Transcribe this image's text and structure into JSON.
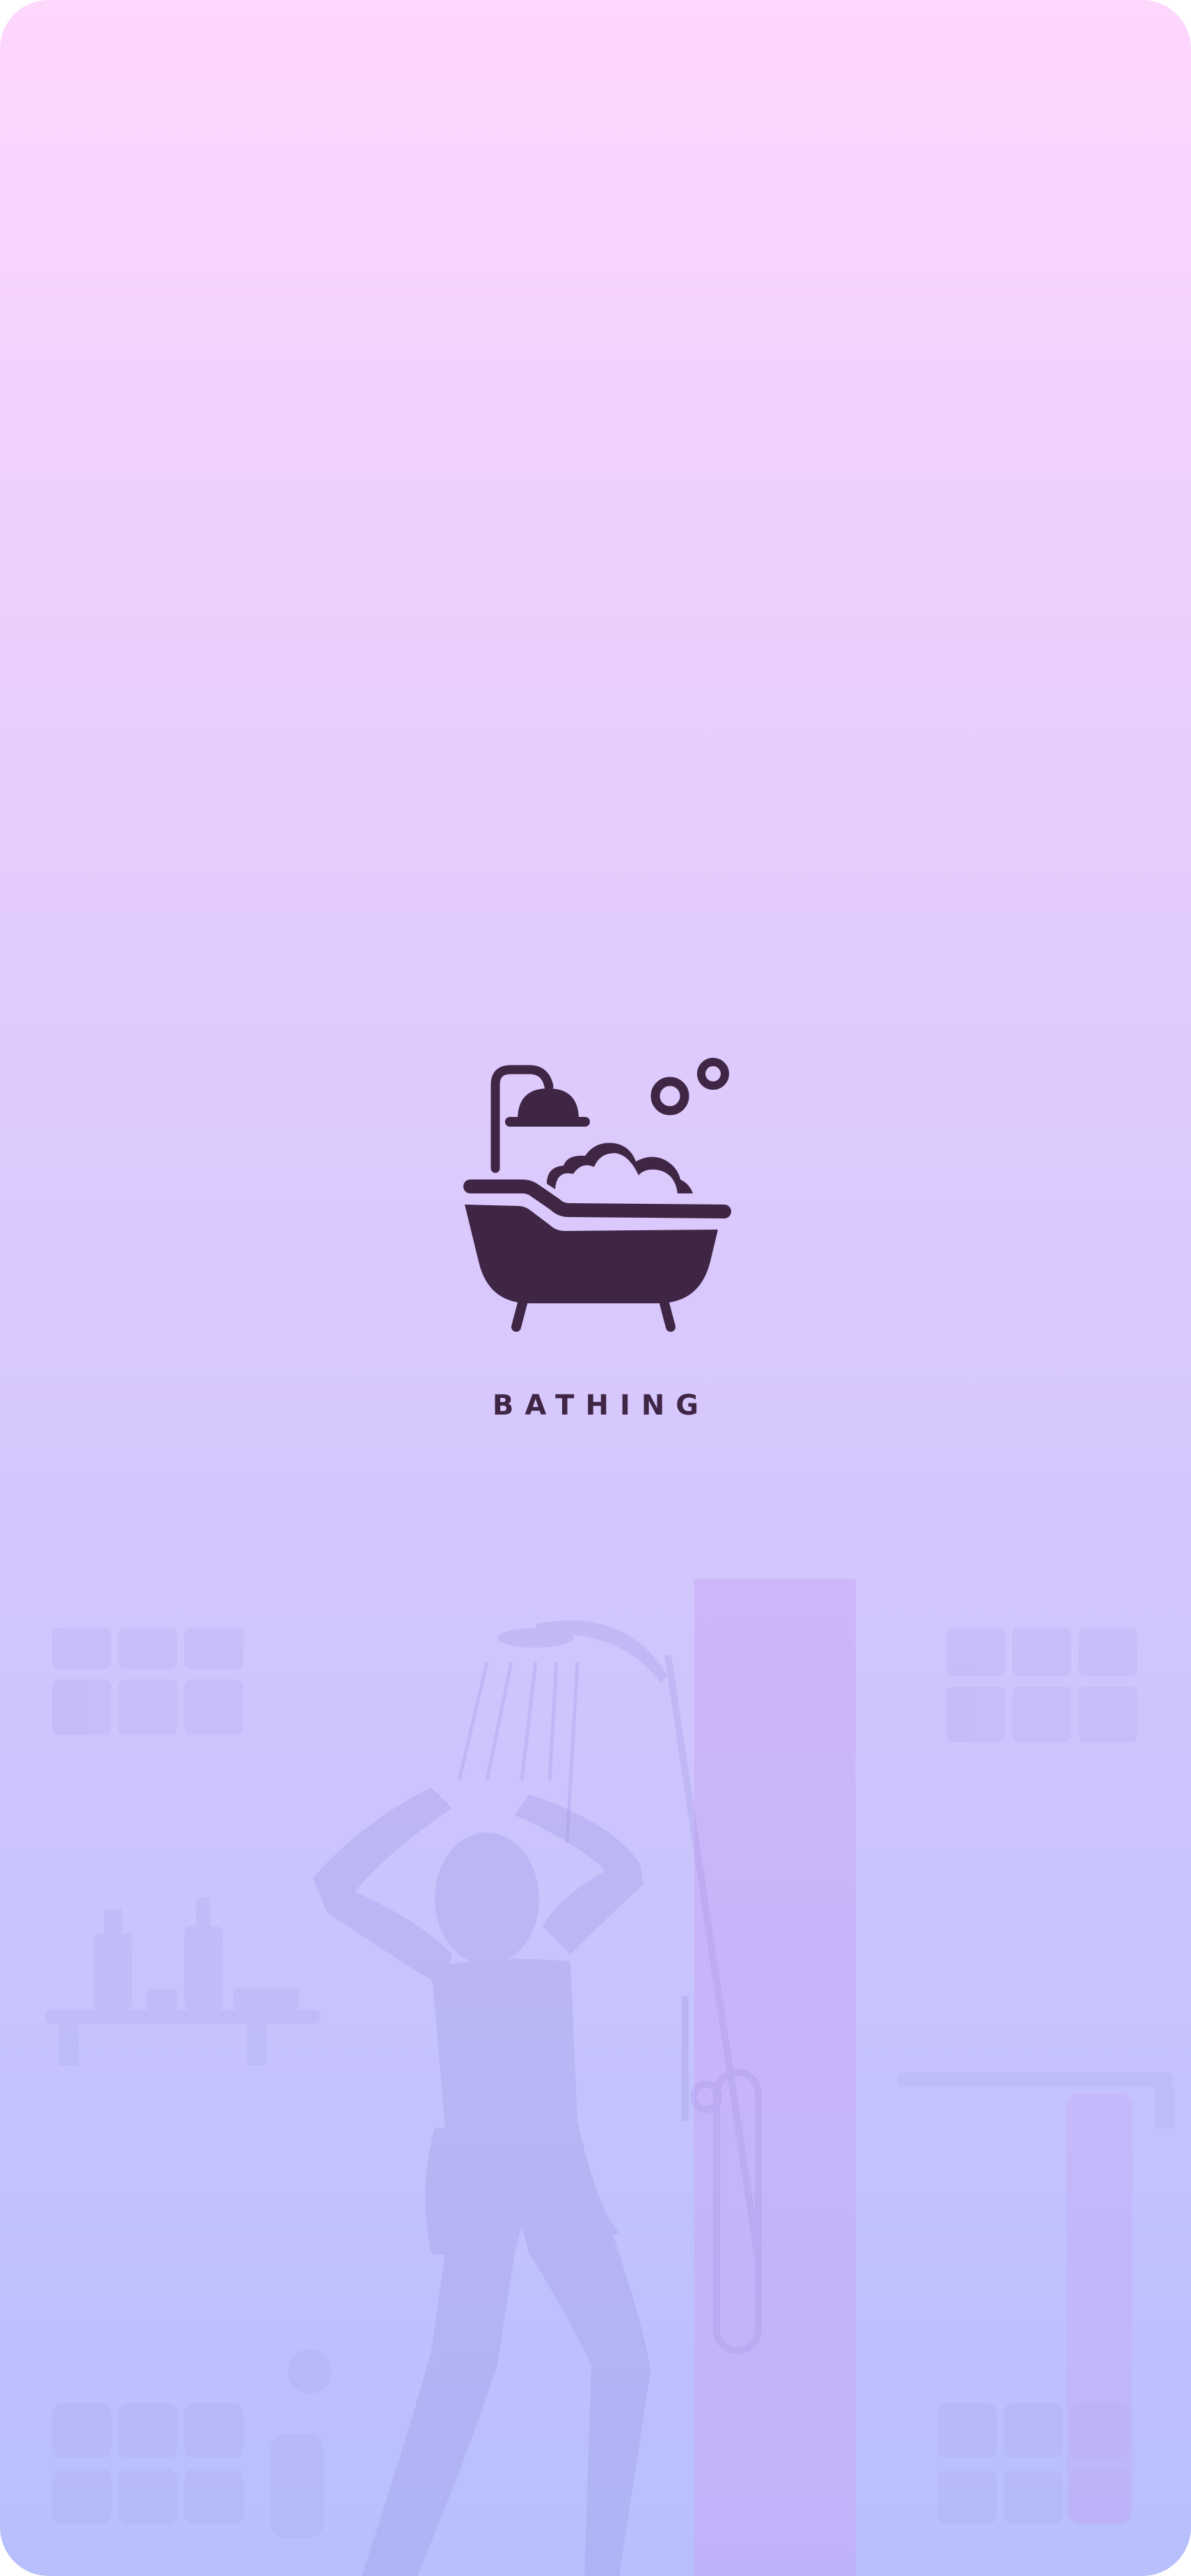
{
  "app": {
    "name": "BATHING"
  },
  "logo": {
    "icon": "bathtub-with-shower-and-bubbles-icon"
  },
  "background": {
    "illustration": "person-showering-illustration",
    "gradient_top": "#fed7fd",
    "gradient_bottom": "#b7bffd"
  },
  "colors": {
    "icon": "#3f2645",
    "text": "#3f2645"
  }
}
